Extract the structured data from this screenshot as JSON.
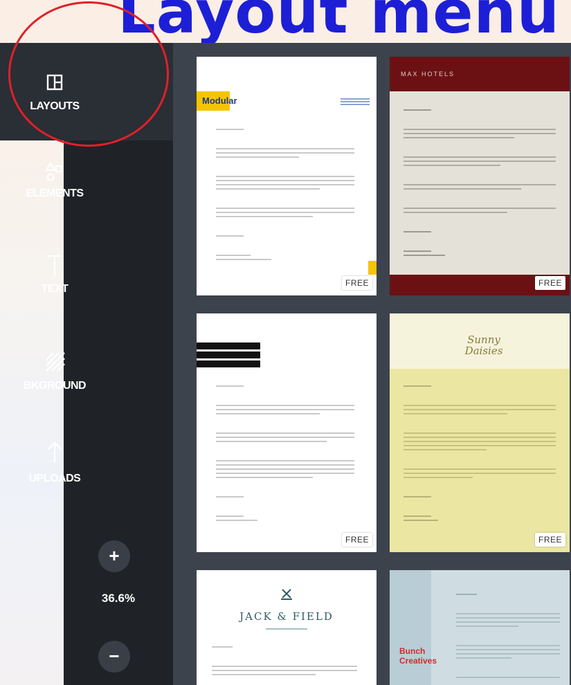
{
  "heading": "Layout menu",
  "sidebar": {
    "items": [
      {
        "label": "LAYOUTS",
        "icon": "layouts-icon"
      },
      {
        "label": "ELEMENTS",
        "icon": "elements-icon"
      },
      {
        "label": "TEXT",
        "icon": "text-icon"
      },
      {
        "label": "BKGROUND",
        "icon": "background-icon"
      },
      {
        "label": "UPLOADS",
        "icon": "uploads-icon"
      }
    ],
    "zoom": {
      "plus": "+",
      "value": "36.6%",
      "minus": "−"
    }
  },
  "templates": [
    {
      "name": "Modular",
      "badge": "FREE"
    },
    {
      "name": "MAX HOTELS",
      "badge": "FREE"
    },
    {
      "name": "",
      "badge": "FREE"
    },
    {
      "name": "Sunny Daisies",
      "badge": "FREE"
    },
    {
      "name": "JACK & FIELD",
      "badge": ""
    },
    {
      "name": "Bunch Creatives",
      "badge": ""
    }
  ],
  "colors": {
    "accent_heading": "#1d1fd6",
    "callout": "#e0202a",
    "sidebar": "#2a2e35",
    "panel": "#3d434c"
  }
}
